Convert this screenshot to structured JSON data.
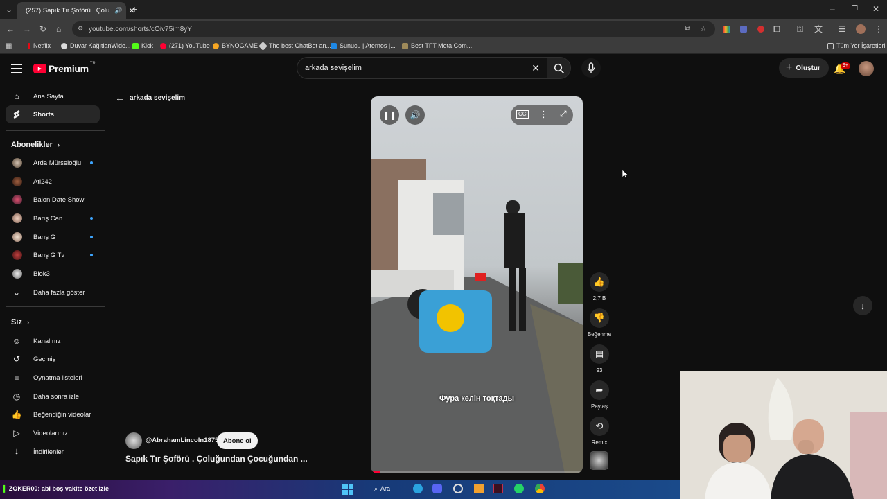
{
  "browser": {
    "tab_title": "(257) Sapık Tır Şoförü . Çolu",
    "url": "youtube.com/shorts/cOiv75im8yY",
    "bookmarks": [
      "Netflix",
      "Duvar KağıtlanWide...",
      "Kick",
      "(271) YouTube",
      "BYNOGAME",
      "The best ChatBot an...",
      "Sunucu | Aternos |...",
      "Best TFT Meta Com..."
    ],
    "all_bookmarks": "Tüm Yer İşaretleri"
  },
  "header": {
    "logo_text": "Premium",
    "logo_region": "TR",
    "search_value": "arkada sevişelim",
    "create_label": "Oluştur",
    "notif_badge": "9+"
  },
  "sidebar": {
    "main": [
      {
        "label": "Ana Sayfa",
        "icon": "home-icon"
      },
      {
        "label": "Shorts",
        "icon": "shorts-icon"
      }
    ],
    "subs_header": "Abonelikler",
    "subs": [
      {
        "label": "Arda Mürseloğlu",
        "new": true
      },
      {
        "label": "Ati242",
        "new": false
      },
      {
        "label": "Balon Date Show",
        "new": false
      },
      {
        "label": "Barış Can",
        "new": true
      },
      {
        "label": "Barış G",
        "new": true
      },
      {
        "label": "Barış G Tv",
        "new": true
      },
      {
        "label": "Blok3",
        "new": false
      }
    ],
    "show_more": "Daha fazla göster",
    "you_header": "Siz",
    "you": [
      {
        "label": "Kanalınız",
        "icon": "channel-icon"
      },
      {
        "label": "Geçmiş",
        "icon": "history-icon"
      },
      {
        "label": "Oynatma listeleri",
        "icon": "playlist-icon"
      },
      {
        "label": "Daha sonra izle",
        "icon": "clock-icon"
      },
      {
        "label": "Beğendiğin videolar",
        "icon": "like-icon"
      },
      {
        "label": "Videolarınız",
        "icon": "video-icon"
      },
      {
        "label": "İndirilenler",
        "icon": "download-icon"
      }
    ]
  },
  "main": {
    "back_label": "arkada sevişelim",
    "channel_handle": "@AbrahamLincoln1875",
    "subscribe_label": "Abone ol",
    "video_title": "Sapık Tır Şoförü . Çoluğundan Çocuğundan ...",
    "caption": "Фура келін тоқтады"
  },
  "actions": {
    "likes": "2,7 B",
    "dislike_label": "Beğenme",
    "comments": "93",
    "share_label": "Paylaş",
    "remix_label": "Remix"
  },
  "taskbar": {
    "chat_user": "ZOKER00",
    "chat_message": ": abi boş vakite özet izle",
    "search_label": "Ara"
  },
  "colors": {
    "yt_red": "#ff0033",
    "accent_blue": "#3ea6ff",
    "bg": "#0f0f0f"
  }
}
